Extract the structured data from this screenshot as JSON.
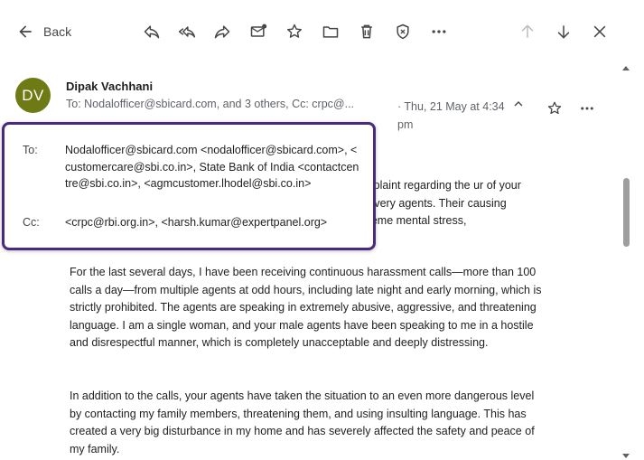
{
  "toolbar": {
    "back_label": "Back",
    "icons": [
      "arrow-left-icon",
      "reply-icon",
      "reply-all-icon",
      "forward-icon",
      "mark-unread-icon",
      "star-icon",
      "folder-icon",
      "trash-icon",
      "shield-icon",
      "more-icon",
      "arrow-up-icon",
      "arrow-down-icon",
      "close-icon"
    ]
  },
  "message": {
    "avatar_initials": "DV",
    "avatar_color": "#6e7a14",
    "sender": "Dipak Vachhani",
    "recipients_summary": "To:  Nodalofficer@sbicard.com, and 3 others, Cc:  crpc@...",
    "date": "· Thu, 21 May at 4:34 pm"
  },
  "popup": {
    "to_label": "To:",
    "to_value": "Nodalofficer@sbicard.com <nodalofficer@sbicard.com>, <customercare@sbi.co.in>, State Bank of India <contactcentre@sbi.co.in>, <agmcustomer.lhodel@sbi.co.in>",
    "cc_label": "Cc:",
    "cc_value": "<crpc@rbi.org.in>, <harsh.kumar@expertpanel.org>",
    "border_color": "#4a2a7a"
  },
  "body": {
    "p1_partial": "complaint regarding the ur of your recovery agents. Their causing extreme mental stress,",
    "p2": "For the last several days, I have been receiving continuous harassment calls—more than 100 calls a day—from multiple agents at odd hours, including late night and early morning, which is strictly prohibited. The agents are speaking in extremely abusive, aggressive, and threatening language. I am a single woman, and your male agents have been speaking to me in a hostile and disrespectful manner, which is completely unacceptable and deeply distressing.",
    "p3": "In addition to the calls, your agents have taken the situation to an even more dangerous level by contacting my family members, threatening them, and using insulting language. This has created a very big disturbance in my home and has severely affected the safety and peace of my family."
  }
}
